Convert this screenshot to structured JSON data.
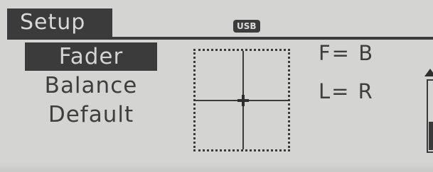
{
  "header": {
    "title": "Setup",
    "source_badge": "USB"
  },
  "menu": {
    "items": [
      {
        "label": "Fader",
        "selected": true
      },
      {
        "label": "Balance",
        "selected": false
      },
      {
        "label": "Default",
        "selected": false
      }
    ]
  },
  "readouts": {
    "fader": "F= B",
    "balance": "L= R"
  },
  "icons": {
    "scroll_up": "triangle-up-icon"
  },
  "colors": {
    "background": "#d4d4d2",
    "dark": "#3b3b3b",
    "text": "#3e3e3e"
  }
}
